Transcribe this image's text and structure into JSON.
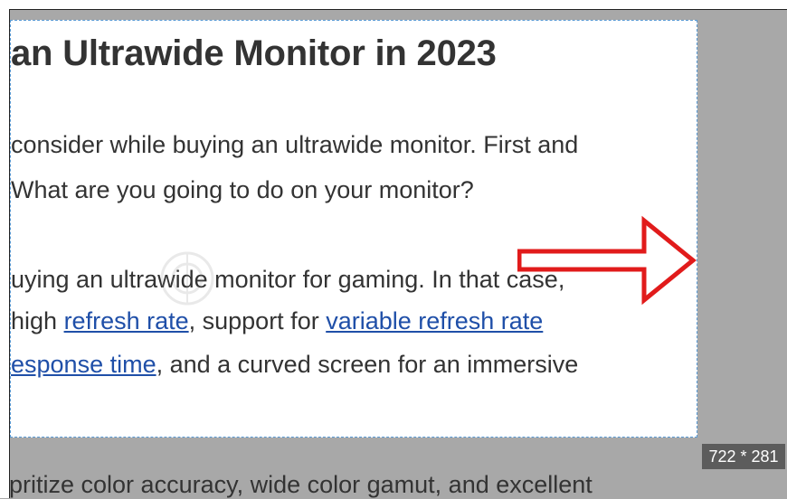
{
  "article": {
    "heading": "an Ultrawide Monitor in 2023",
    "para1_line1": "consider while buying an ultrawide monitor. First and",
    "para1_line2": "What are you going to do on your monitor?",
    "para2_line1": "uying an ultrawide monitor for gaming. In that case,",
    "para2_line2_pre": " high ",
    "link_refresh_rate": "refresh rate",
    "para2_line2_mid": ", support for ",
    "link_variable_refresh_rate": "variable refresh rate",
    "link_response_time": "esponse time",
    "para2_line3_post": ", and a curved screen for an immersive",
    "bottom_line": "pritize color accuracy, wide color gamut, and excellent"
  },
  "overlay": {
    "size_label": "722 * 281"
  },
  "colors": {
    "overlay_gray": "#a8a8a8",
    "selection_border": "#5a9bd5",
    "link_blue": "#1f4fa8",
    "arrow_red": "#e11b1b",
    "badge_bg": "#5c5c5c"
  },
  "icons": {
    "annotation_arrow": "right-arrow-icon",
    "watermark": "quantrimang-watermark-icon"
  }
}
